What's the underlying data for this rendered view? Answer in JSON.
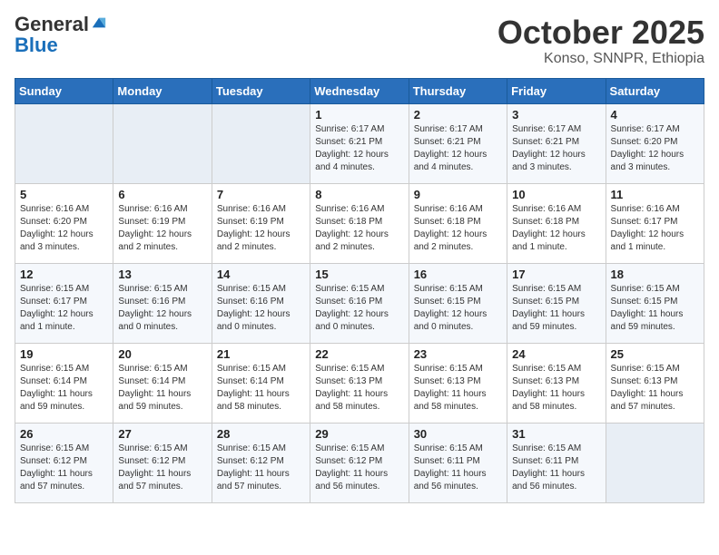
{
  "header": {
    "logo_general": "General",
    "logo_blue": "Blue",
    "month": "October 2025",
    "location": "Konso, SNNPR, Ethiopia"
  },
  "weekdays": [
    "Sunday",
    "Monday",
    "Tuesday",
    "Wednesday",
    "Thursday",
    "Friday",
    "Saturday"
  ],
  "weeks": [
    [
      {
        "day": "",
        "sunrise": "",
        "sunset": "",
        "daylight": ""
      },
      {
        "day": "",
        "sunrise": "",
        "sunset": "",
        "daylight": ""
      },
      {
        "day": "",
        "sunrise": "",
        "sunset": "",
        "daylight": ""
      },
      {
        "day": "1",
        "sunrise": "6:17 AM",
        "sunset": "6:21 PM",
        "daylight": "12 hours and 4 minutes."
      },
      {
        "day": "2",
        "sunrise": "6:17 AM",
        "sunset": "6:21 PM",
        "daylight": "12 hours and 4 minutes."
      },
      {
        "day": "3",
        "sunrise": "6:17 AM",
        "sunset": "6:21 PM",
        "daylight": "12 hours and 3 minutes."
      },
      {
        "day": "4",
        "sunrise": "6:17 AM",
        "sunset": "6:20 PM",
        "daylight": "12 hours and 3 minutes."
      }
    ],
    [
      {
        "day": "5",
        "sunrise": "6:16 AM",
        "sunset": "6:20 PM",
        "daylight": "12 hours and 3 minutes."
      },
      {
        "day": "6",
        "sunrise": "6:16 AM",
        "sunset": "6:19 PM",
        "daylight": "12 hours and 2 minutes."
      },
      {
        "day": "7",
        "sunrise": "6:16 AM",
        "sunset": "6:19 PM",
        "daylight": "12 hours and 2 minutes."
      },
      {
        "day": "8",
        "sunrise": "6:16 AM",
        "sunset": "6:18 PM",
        "daylight": "12 hours and 2 minutes."
      },
      {
        "day": "9",
        "sunrise": "6:16 AM",
        "sunset": "6:18 PM",
        "daylight": "12 hours and 2 minutes."
      },
      {
        "day": "10",
        "sunrise": "6:16 AM",
        "sunset": "6:18 PM",
        "daylight": "12 hours and 1 minute."
      },
      {
        "day": "11",
        "sunrise": "6:16 AM",
        "sunset": "6:17 PM",
        "daylight": "12 hours and 1 minute."
      }
    ],
    [
      {
        "day": "12",
        "sunrise": "6:15 AM",
        "sunset": "6:17 PM",
        "daylight": "12 hours and 1 minute."
      },
      {
        "day": "13",
        "sunrise": "6:15 AM",
        "sunset": "6:16 PM",
        "daylight": "12 hours and 0 minutes."
      },
      {
        "day": "14",
        "sunrise": "6:15 AM",
        "sunset": "6:16 PM",
        "daylight": "12 hours and 0 minutes."
      },
      {
        "day": "15",
        "sunrise": "6:15 AM",
        "sunset": "6:16 PM",
        "daylight": "12 hours and 0 minutes."
      },
      {
        "day": "16",
        "sunrise": "6:15 AM",
        "sunset": "6:15 PM",
        "daylight": "12 hours and 0 minutes."
      },
      {
        "day": "17",
        "sunrise": "6:15 AM",
        "sunset": "6:15 PM",
        "daylight": "11 hours and 59 minutes."
      },
      {
        "day": "18",
        "sunrise": "6:15 AM",
        "sunset": "6:15 PM",
        "daylight": "11 hours and 59 minutes."
      }
    ],
    [
      {
        "day": "19",
        "sunrise": "6:15 AM",
        "sunset": "6:14 PM",
        "daylight": "11 hours and 59 minutes."
      },
      {
        "day": "20",
        "sunrise": "6:15 AM",
        "sunset": "6:14 PM",
        "daylight": "11 hours and 59 minutes."
      },
      {
        "day": "21",
        "sunrise": "6:15 AM",
        "sunset": "6:14 PM",
        "daylight": "11 hours and 58 minutes."
      },
      {
        "day": "22",
        "sunrise": "6:15 AM",
        "sunset": "6:13 PM",
        "daylight": "11 hours and 58 minutes."
      },
      {
        "day": "23",
        "sunrise": "6:15 AM",
        "sunset": "6:13 PM",
        "daylight": "11 hours and 58 minutes."
      },
      {
        "day": "24",
        "sunrise": "6:15 AM",
        "sunset": "6:13 PM",
        "daylight": "11 hours and 58 minutes."
      },
      {
        "day": "25",
        "sunrise": "6:15 AM",
        "sunset": "6:13 PM",
        "daylight": "11 hours and 57 minutes."
      }
    ],
    [
      {
        "day": "26",
        "sunrise": "6:15 AM",
        "sunset": "6:12 PM",
        "daylight": "11 hours and 57 minutes."
      },
      {
        "day": "27",
        "sunrise": "6:15 AM",
        "sunset": "6:12 PM",
        "daylight": "11 hours and 57 minutes."
      },
      {
        "day": "28",
        "sunrise": "6:15 AM",
        "sunset": "6:12 PM",
        "daylight": "11 hours and 57 minutes."
      },
      {
        "day": "29",
        "sunrise": "6:15 AM",
        "sunset": "6:12 PM",
        "daylight": "11 hours and 56 minutes."
      },
      {
        "day": "30",
        "sunrise": "6:15 AM",
        "sunset": "6:11 PM",
        "daylight": "11 hours and 56 minutes."
      },
      {
        "day": "31",
        "sunrise": "6:15 AM",
        "sunset": "6:11 PM",
        "daylight": "11 hours and 56 minutes."
      },
      {
        "day": "",
        "sunrise": "",
        "sunset": "",
        "daylight": ""
      }
    ]
  ],
  "labels": {
    "sunrise": "Sunrise:",
    "sunset": "Sunset:",
    "daylight": "Daylight:"
  }
}
